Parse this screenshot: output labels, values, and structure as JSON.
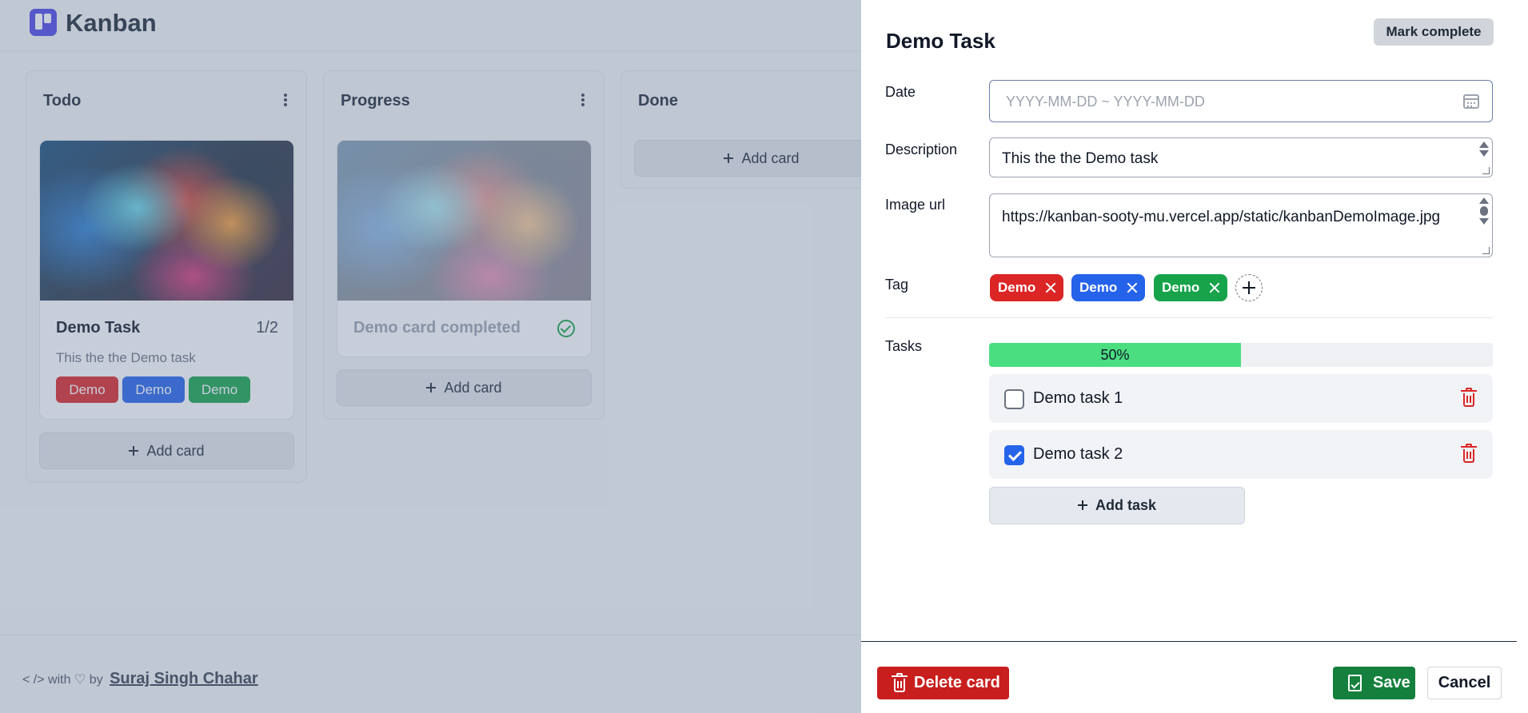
{
  "header": {
    "title": "Kanban",
    "logo_icon": "kanban-logo-icon"
  },
  "columns": [
    {
      "title": "Todo",
      "cards": [
        {
          "title": "Demo Task",
          "task_count": "1/2",
          "description": "This the the Demo task",
          "tags": [
            {
              "label": "Demo",
              "color": "#dc2626"
            },
            {
              "label": "Demo",
              "color": "#2563eb"
            },
            {
              "label": "Demo",
              "color": "#16a34a"
            }
          ]
        }
      ],
      "add_card_label": "Add card"
    },
    {
      "title": "Progress",
      "cards": [
        {
          "title": "Demo card completed",
          "completed": true
        }
      ],
      "add_card_label": "Add card"
    },
    {
      "title": "Done",
      "cards": [],
      "add_card_label": "Add card"
    }
  ],
  "footer": {
    "prefix": "< /> with ♡ by",
    "author": "Suraj Singh Chahar"
  },
  "drawer": {
    "title": "Demo Task",
    "mark_complete_label": "Mark complete",
    "date": {
      "label": "Date",
      "placeholder": "YYYY-MM-DD ~ YYYY-MM-DD"
    },
    "description": {
      "label": "Description",
      "value": "This the the Demo task"
    },
    "image_url": {
      "label": "Image url",
      "value": "https://kanban-sooty-mu.vercel.app/static/kanbanDemoImage.jpg"
    },
    "tags": {
      "label": "Tag",
      "items": [
        {
          "label": "Demo",
          "color": "#dc2626"
        },
        {
          "label": "Demo",
          "color": "#2563eb"
        },
        {
          "label": "Demo",
          "color": "#16a34a"
        }
      ]
    },
    "tasks": {
      "label": "Tasks",
      "progress_fraction": 0.5,
      "progress_text": "50%",
      "items": [
        {
          "label": "Demo task 1",
          "checked": false
        },
        {
          "label": "Demo task 2",
          "checked": true
        }
      ],
      "add_task_label": "Add task"
    },
    "buttons": {
      "delete": "Delete card",
      "save": "Save",
      "cancel": "Cancel"
    }
  }
}
